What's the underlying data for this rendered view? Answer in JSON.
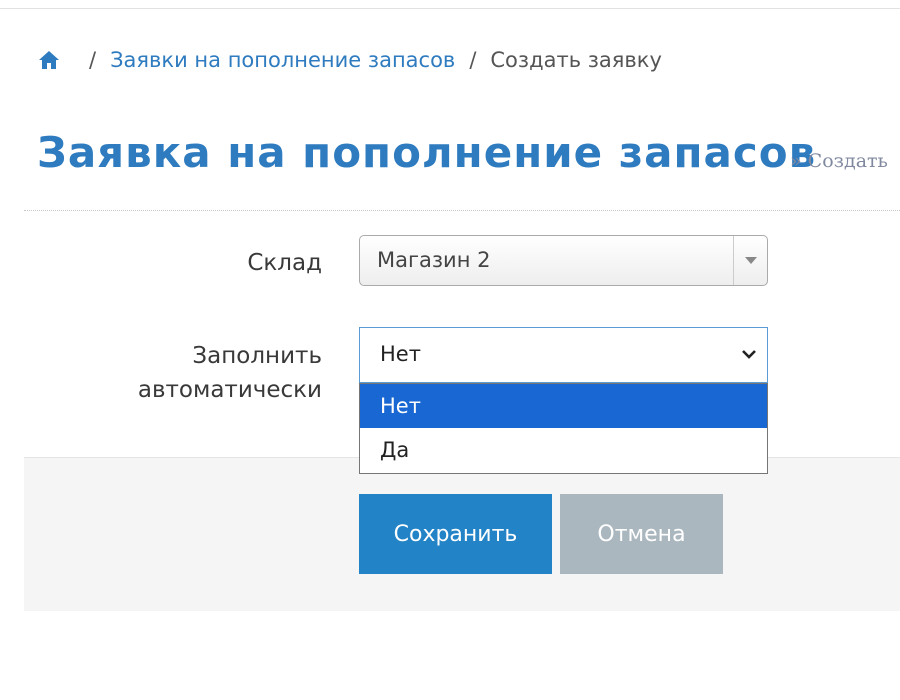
{
  "breadcrumb": {
    "home_icon": "home-icon",
    "separator": "/",
    "items": [
      "Заявки на пополнение запасов",
      "Создать заявку"
    ]
  },
  "page": {
    "title": "Заявка на пополнение запасов",
    "subtitle": "» Создать"
  },
  "form": {
    "warehouse": {
      "label": "Склад",
      "value": "Магазин 2"
    },
    "autofill": {
      "label_line1": "Заполнить",
      "label_line2": "автоматически",
      "value": "Нет",
      "options": [
        "Нет",
        "Да"
      ],
      "highlighted_option": "Нет"
    }
  },
  "actions": {
    "save_label": "Сохранить",
    "cancel_label": "Отмена"
  },
  "colors": {
    "accent": "#2e7bbf",
    "save_button": "#2283c6",
    "cancel_button": "#abb7bf",
    "option_highlight": "#1967d2",
    "footer_background": "#f5f5f5"
  }
}
